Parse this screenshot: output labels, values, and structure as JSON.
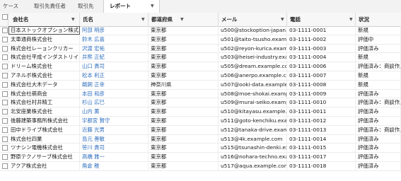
{
  "tabs": [
    {
      "label": "ケース"
    },
    {
      "label": "取引先責任者"
    },
    {
      "label": "取引先"
    },
    {
      "label": "レポート",
      "active": true
    }
  ],
  "columns": [
    {
      "key": "company",
      "label": "会社名"
    },
    {
      "key": "name",
      "label": "氏名"
    },
    {
      "key": "pref",
      "label": "都道府県"
    },
    {
      "key": "email",
      "label": "メール"
    },
    {
      "key": "phone",
      "label": "電話"
    },
    {
      "key": "status",
      "label": "状況"
    }
  ],
  "rows": [
    {
      "company": "日本ストックオプション株式...",
      "name": "阿部 明彦",
      "pref": "東京都",
      "email": "u500@stockoption-japan.exa...",
      "phone": "03-1111-0001",
      "status": "新規"
    },
    {
      "company": "太車通商株式会社",
      "name": "鈴木 広喜",
      "pref": "東京都",
      "email": "u501@taito-tsusho.example.com",
      "phone": "03-1111-0002",
      "status": "評価中"
    },
    {
      "company": "株式会社レーョンクリカー",
      "name": "沢渡 宏祐",
      "pref": "東京都",
      "email": "u502@reyon-kurica.example.com",
      "phone": "03-1111-0003",
      "status": "評価済み"
    },
    {
      "company": "株式会社平成インダストリイ...",
      "name": "井熊 正紀",
      "pref": "東京都",
      "email": "u503@heisei-industry.exampl...",
      "phone": "03-1111-0004",
      "status": "新規"
    },
    {
      "company": "ドリーム株式会社",
      "name": "山口 貴司",
      "pref": "東京都",
      "email": "u505@dream.example.com",
      "phone": "03-1111-0006",
      "status": "評価済み：商談作成"
    },
    {
      "company": "アネルボ株式会社",
      "name": "松本 利正",
      "pref": "東京都",
      "email": "u506@anerpo.example.com",
      "phone": "03-1111-0007",
      "status": "新規"
    },
    {
      "company": "株式会社大木データ",
      "name": "鵜飼 正幸",
      "pref": "神奈川県",
      "email": "u507@ooki-data.example.com",
      "phone": "03-1111-0008",
      "status": "新規"
    },
    {
      "company": "株式会社萌商会",
      "name": "本田 和彦",
      "pref": "東京都",
      "email": "u508@moe-shokai.example.c...",
      "phone": "03-1111-0009",
      "status": "評価済み"
    },
    {
      "company": "株式会社村井精工",
      "name": "杉山 広巳",
      "pref": "東京都",
      "email": "u509@murai-seiko.example.c...",
      "phone": "03-1111-0010",
      "status": "評価済み：商談作成"
    },
    {
      "company": "北安座業株式会社",
      "name": "山内 薫",
      "pref": "東京都",
      "email": "u510@kitayasu.example.com",
      "phone": "03-1111-0011",
      "status": "評価済み"
    },
    {
      "company": "後藤建築事務所株式会社",
      "name": "宇都宮 賢守",
      "pref": "東京都",
      "email": "u511@goto-kenchiku.example...",
      "phone": "03-1111-0012",
      "status": "評価済み"
    },
    {
      "company": "田中ドライブ株式会社",
      "name": "近藤 光男",
      "pref": "東京都",
      "email": "u512@tanaka-drive.example...",
      "phone": "03-1111-0013",
      "status": "評価済み：商談作成"
    },
    {
      "company": "株式会社四業",
      "name": "島元 善敏",
      "pref": "東京都",
      "email": "u513@4k.example.com",
      "phone": "03-1111-0014",
      "status": "評価済み"
    },
    {
      "company": "ツナシン電機株式会社",
      "name": "笹川 貴司",
      "pref": "東京都",
      "email": "u515@tsunashin-denki.exam...",
      "phone": "03-1111-0015",
      "status": "評価済み"
    },
    {
      "company": "野原テクノサーブ株式会社",
      "name": "高橋 雅一",
      "pref": "東京都",
      "email": "u516@nohara-techno.exampl...",
      "phone": "03-1111-0017",
      "status": "評価済み"
    },
    {
      "company": "アクア株式会社",
      "name": "角倉 稚",
      "pref": "東京都",
      "email": "u517@aqua.example.com",
      "phone": "03-1111-0018",
      "status": "評価済み"
    }
  ]
}
